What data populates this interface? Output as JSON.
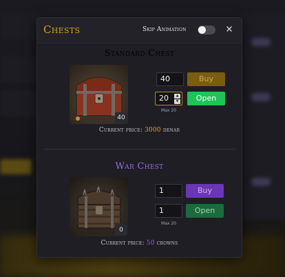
{
  "modal": {
    "title": "Chests",
    "skip_animation_label": "Skip Animation",
    "skip_animation_on": false,
    "close_icon": "close-icon"
  },
  "chests": [
    {
      "name": "Standard Chest",
      "name_color": "#d9a11c",
      "count": "40",
      "price_prefix": "Current price:",
      "price_value": "3000",
      "price_unit": "denar",
      "buy_qty": "40",
      "buy_label": "Buy",
      "open_qty": "20",
      "open_label": "Open",
      "max_label": "Max 20"
    },
    {
      "name": "War Chest",
      "name_color": "#9a6ae0",
      "count": "0",
      "price_prefix": "Current price:",
      "price_value": "50",
      "price_unit": "crowns",
      "buy_qty": "1",
      "buy_label": "Buy",
      "open_qty": "1",
      "open_label": "Open",
      "max_label": "Max 20"
    }
  ]
}
